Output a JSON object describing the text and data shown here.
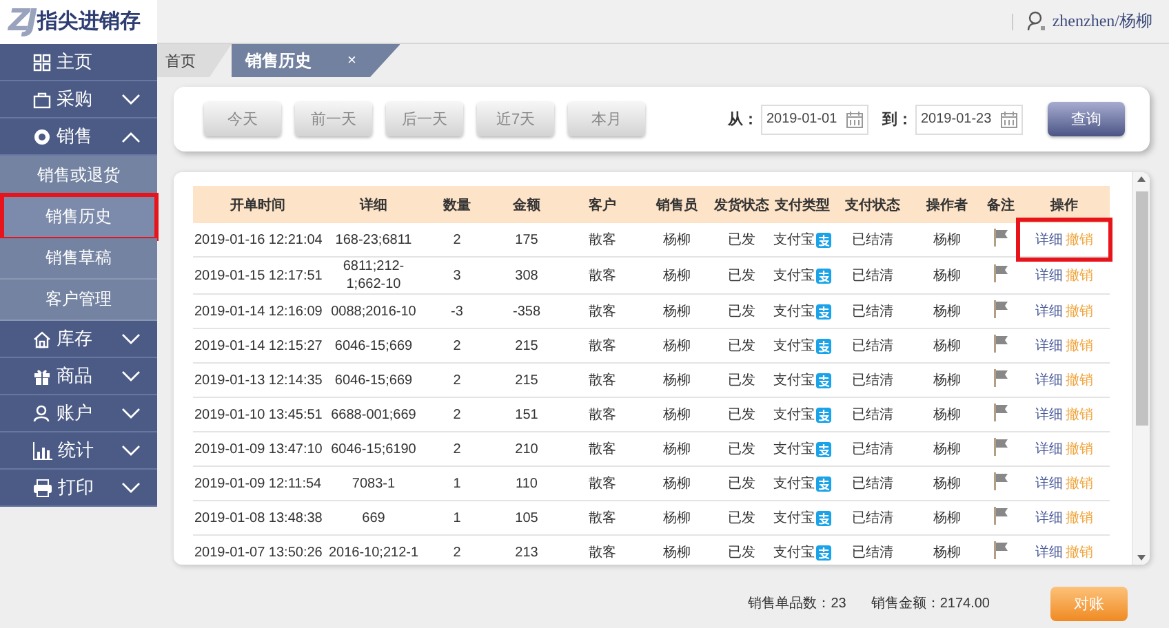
{
  "header": {
    "logo_mark": "ZJ",
    "app_name": "指尖进销存",
    "user": "zhenzhen/杨柳"
  },
  "sidebar": {
    "items": [
      {
        "label": "主页",
        "kind": "link"
      },
      {
        "label": "采购",
        "kind": "group",
        "expanded": false
      },
      {
        "label": "销售",
        "kind": "group",
        "expanded": true,
        "children": [
          {
            "label": "销售或退货",
            "selected": false,
            "highlighted": false
          },
          {
            "label": "销售历史",
            "selected": true,
            "highlighted": true
          },
          {
            "label": "销售草稿",
            "selected": false,
            "highlighted": false
          },
          {
            "label": "客户管理",
            "selected": false,
            "highlighted": false
          }
        ]
      },
      {
        "label": "库存",
        "kind": "group",
        "expanded": false
      },
      {
        "label": "商品",
        "kind": "group",
        "expanded": false
      },
      {
        "label": "账户",
        "kind": "group",
        "expanded": false
      },
      {
        "label": "统计",
        "kind": "group",
        "expanded": false
      },
      {
        "label": "打印",
        "kind": "group",
        "expanded": false
      }
    ]
  },
  "tabs": [
    {
      "label": "首页",
      "selected": false
    },
    {
      "label": "销售历史",
      "selected": true,
      "close": "×"
    }
  ],
  "filter": {
    "quick_buttons": [
      "今天",
      "前一天",
      "后一天",
      "近7天",
      "本月"
    ],
    "from_label": "从：",
    "from_value": "2019-01-01",
    "to_label": "到：",
    "to_value": "2019-01-23",
    "query_button": "查询"
  },
  "table": {
    "columns": [
      "开单时间",
      "详细",
      "数量",
      "金额",
      "客户",
      "销售员",
      "发货状态",
      "支付类型",
      "支付状态",
      "操作者",
      "备注",
      "操作"
    ],
    "rows": [
      {
        "time": "2019-01-16 12:21:04",
        "detail": "168-23;6811",
        "qty": "2",
        "amount": "175",
        "customer": "散客",
        "seller": "杨柳",
        "ship_status": "已发",
        "pay_type": "支付宝",
        "pay_status": "已结清",
        "operator": "杨柳",
        "actions": [
          "详细",
          "撤销"
        ],
        "highlighted": true
      },
      {
        "time": "2019-01-15 12:17:51",
        "detail": "6811;212-1;662-10",
        "qty": "3",
        "amount": "308",
        "customer": "散客",
        "seller": "杨柳",
        "ship_status": "已发",
        "pay_type": "支付宝",
        "pay_status": "已结清",
        "operator": "杨柳",
        "actions": [
          "详细",
          "撤销"
        ],
        "highlighted": false
      },
      {
        "time": "2019-01-14 12:16:09",
        "detail": "0088;2016-10",
        "qty": "-3",
        "amount": "-358",
        "customer": "散客",
        "seller": "杨柳",
        "ship_status": "已发",
        "pay_type": "支付宝",
        "pay_status": "已结清",
        "operator": "杨柳",
        "actions": [
          "详细",
          "撤销"
        ],
        "highlighted": false
      },
      {
        "time": "2019-01-14 12:15:27",
        "detail": "6046-15;669",
        "qty": "2",
        "amount": "215",
        "customer": "散客",
        "seller": "杨柳",
        "ship_status": "已发",
        "pay_type": "支付宝",
        "pay_status": "已结清",
        "operator": "杨柳",
        "actions": [
          "详细",
          "撤销"
        ],
        "highlighted": false
      },
      {
        "time": "2019-01-13 12:14:35",
        "detail": "6046-15;669",
        "qty": "2",
        "amount": "215",
        "customer": "散客",
        "seller": "杨柳",
        "ship_status": "已发",
        "pay_type": "支付宝",
        "pay_status": "已结清",
        "operator": "杨柳",
        "actions": [
          "详细",
          "撤销"
        ],
        "highlighted": false
      },
      {
        "time": "2019-01-10 13:45:51",
        "detail": "6688-001;669",
        "qty": "2",
        "amount": "151",
        "customer": "散客",
        "seller": "杨柳",
        "ship_status": "已发",
        "pay_type": "支付宝",
        "pay_status": "已结清",
        "operator": "杨柳",
        "actions": [
          "详细",
          "撤销"
        ],
        "highlighted": false
      },
      {
        "time": "2019-01-09 13:47:10",
        "detail": "6046-15;6190",
        "qty": "2",
        "amount": "210",
        "customer": "散客",
        "seller": "杨柳",
        "ship_status": "已发",
        "pay_type": "支付宝",
        "pay_status": "已结清",
        "operator": "杨柳",
        "actions": [
          "详细",
          "撤销"
        ],
        "highlighted": false
      },
      {
        "time": "2019-01-09 12:11:54",
        "detail": "7083-1",
        "qty": "1",
        "amount": "110",
        "customer": "散客",
        "seller": "杨柳",
        "ship_status": "已发",
        "pay_type": "支付宝",
        "pay_status": "已结清",
        "operator": "杨柳",
        "actions": [
          "详细",
          "撤销"
        ],
        "highlighted": false
      },
      {
        "time": "2019-01-08 13:48:38",
        "detail": "669",
        "qty": "1",
        "amount": "105",
        "customer": "散客",
        "seller": "杨柳",
        "ship_status": "已发",
        "pay_type": "支付宝",
        "pay_status": "已结清",
        "operator": "杨柳",
        "actions": [
          "详细",
          "撤销"
        ],
        "highlighted": false
      },
      {
        "time": "2019-01-07 13:50:26",
        "detail": "2016-10;212-1",
        "qty": "2",
        "amount": "213",
        "customer": "散客",
        "seller": "杨柳",
        "ship_status": "已发",
        "pay_type": "支付宝",
        "pay_status": "已结清",
        "operator": "杨柳",
        "actions": [
          "详细",
          "撤销"
        ],
        "highlighted": false
      }
    ]
  },
  "summary": {
    "item_count": "销售单品数：23",
    "amount": "销售金额：2174.00",
    "reconcile_button": "对账"
  }
}
